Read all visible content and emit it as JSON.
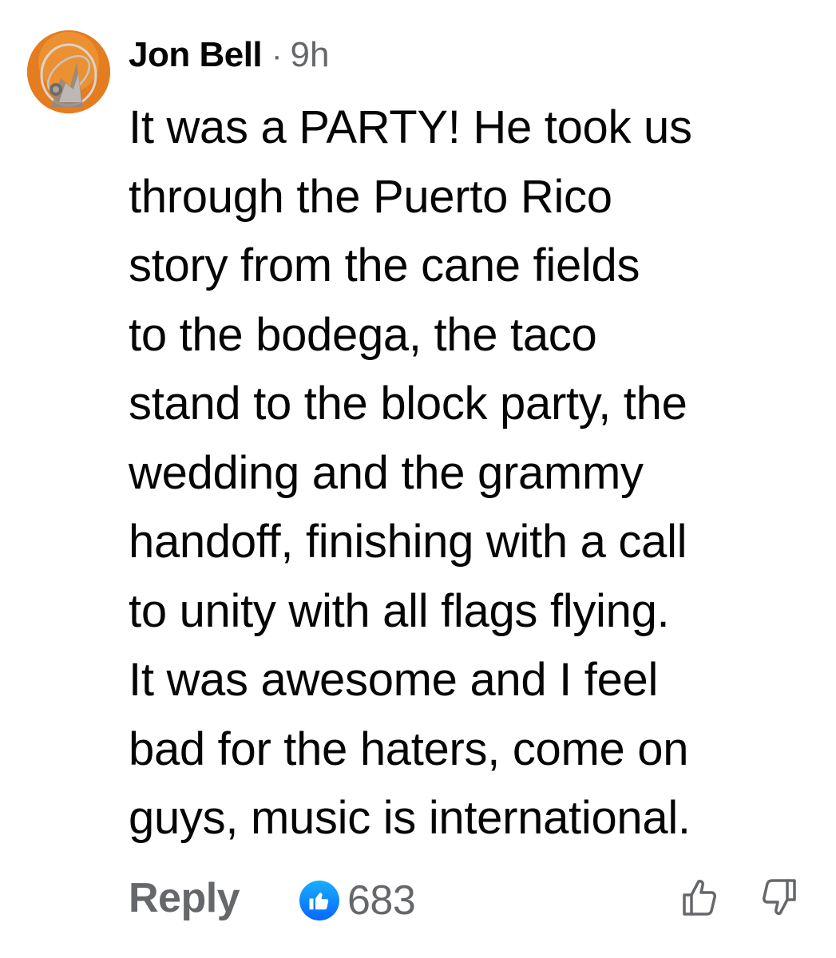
{
  "comment": {
    "author": "Jon Bell",
    "separator": "·",
    "time": "9h",
    "text_lines": [
      "It was a PARTY! He took us",
      "through the Puerto Rico",
      "story from the cane fields",
      "to the bodega, the taco",
      "stand to the block party, the",
      "wedding and the grammy",
      "handoff, finishing with a call",
      "to unity with all flags flying.",
      "It was awesome and I feel",
      "bad for the haters, come on",
      "guys, music is international."
    ],
    "reply_label": "Reply",
    "reaction_count": "683",
    "reaction_icon": "like-icon",
    "vote_icons": [
      "upvote-icon",
      "downvote-icon"
    ]
  },
  "colors": {
    "text": "#050505",
    "secondary": "#65676b",
    "like_blue": "#0866ff"
  }
}
